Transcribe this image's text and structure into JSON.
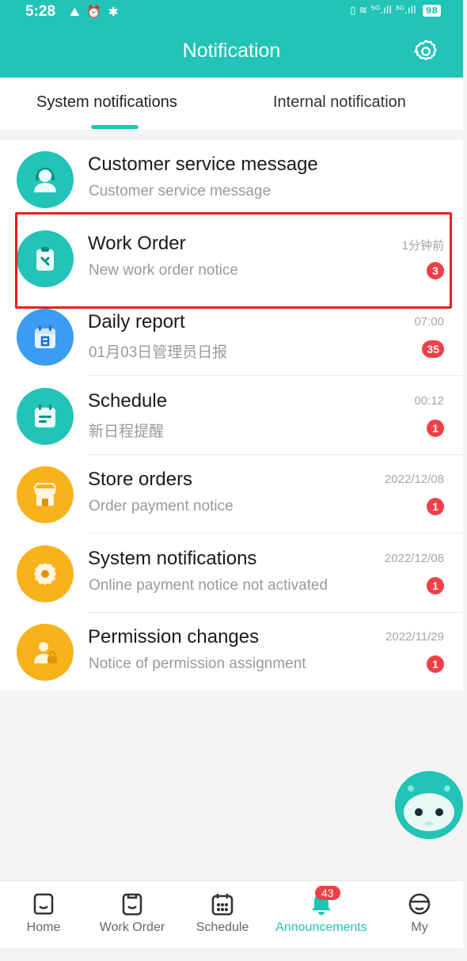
{
  "status_bar": {
    "time": "5:28",
    "left_icons": "⛰ ⏰ ✱",
    "right_icons": "▯ ≋ ⁵ᴳ.ıll ³ᴳ.ıll",
    "battery": "98"
  },
  "header": {
    "title": "Notification",
    "settings_icon": "gear-icon"
  },
  "tabs": [
    {
      "label": "System notifications",
      "active": true
    },
    {
      "label": "Internal notification",
      "active": false
    }
  ],
  "notifications": [
    {
      "title": "Customer service message",
      "subtitle": "Customer service message",
      "time": "",
      "badge": "",
      "icon": "customer-service-icon",
      "color": "#21c4b6"
    },
    {
      "title": "Work Order",
      "subtitle": "New work order notice",
      "time": "1分钟前",
      "badge": "3",
      "icon": "clipboard-wrench-icon",
      "color": "#21c4b6"
    },
    {
      "title": "Daily report",
      "subtitle": "01月03日管理员日报",
      "time": "07:00",
      "badge": "35",
      "icon": "calendar-report-icon",
      "color": "#3a9cf2"
    },
    {
      "title": "Schedule",
      "subtitle": "新日程提醒",
      "time": "00:12",
      "badge": "1",
      "icon": "schedule-icon",
      "color": "#21c4b6"
    },
    {
      "title": "Store orders",
      "subtitle": "Order payment notice",
      "time": "2022/12/08",
      "badge": "1",
      "icon": "store-icon",
      "color": "#f8b21c"
    },
    {
      "title": "System notifications",
      "subtitle": "Online payment notice not activated",
      "time": "2022/12/08",
      "badge": "1",
      "icon": "gear-icon",
      "color": "#f8b21c"
    },
    {
      "title": "Permission changes",
      "subtitle": "Notice of permission assignment",
      "time": "2022/11/29",
      "badge": "1",
      "icon": "user-lock-icon",
      "color": "#f8b21c"
    }
  ],
  "bottom_nav": [
    {
      "label": "Home",
      "icon": "home-icon",
      "active": false,
      "badge": ""
    },
    {
      "label": "Work Order",
      "icon": "work-order-icon",
      "active": false,
      "badge": ""
    },
    {
      "label": "Schedule",
      "icon": "calendar-icon",
      "active": false,
      "badge": ""
    },
    {
      "label": "Announcements",
      "icon": "bell-icon",
      "active": true,
      "badge": "43"
    },
    {
      "label": "My",
      "icon": "profile-icon",
      "active": false,
      "badge": ""
    }
  ],
  "colors": {
    "accent": "#21c4b6",
    "badge": "#ef4048",
    "highlight": "#e8201c"
  }
}
